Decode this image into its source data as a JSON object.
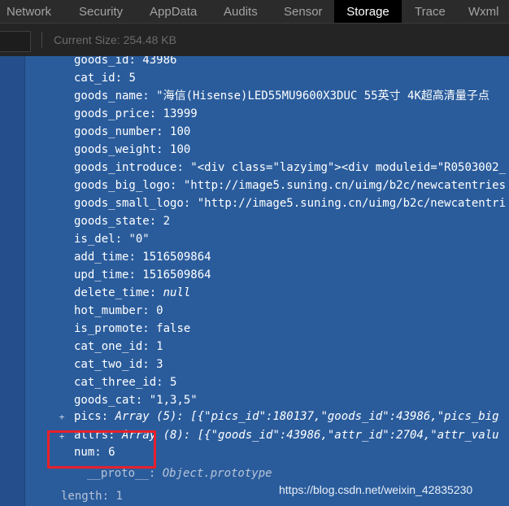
{
  "tabs": [
    "Network",
    "Security",
    "AppData",
    "Audits",
    "Sensor",
    "Storage",
    "Trace",
    "Wxml"
  ],
  "active_tab": "Storage",
  "toolbar": {
    "current_size": "Current Size:  254.48 KB"
  },
  "properties": [
    {
      "key": "goods_id",
      "value": "43986"
    },
    {
      "key": "cat_id",
      "value": "5"
    },
    {
      "key": "goods_name",
      "value": "\"海信(Hisense)LED55MU9600X3DUC 55英寸 4K超高清量子点"
    },
    {
      "key": "goods_price",
      "value": "13999"
    },
    {
      "key": "goods_number",
      "value": "100"
    },
    {
      "key": "goods_weight",
      "value": "100"
    },
    {
      "key": "goods_introduce",
      "value": "\"<div class=\"lazyimg\"><div moduleid=\"R0503002_"
    },
    {
      "key": "goods_big_logo",
      "value": "\"http://image5.suning.cn/uimg/b2c/newcatentries"
    },
    {
      "key": "goods_small_logo",
      "value": "\"http://image5.suning.cn/uimg/b2c/newcatentri"
    },
    {
      "key": "goods_state",
      "value": "2"
    },
    {
      "key": "is_del",
      "value": "\"0\""
    },
    {
      "key": "add_time",
      "value": "1516509864"
    },
    {
      "key": "upd_time",
      "value": "1516509864"
    },
    {
      "key": "delete_time",
      "value": "null"
    },
    {
      "key": "hot_mumber",
      "value": "0"
    },
    {
      "key": "is_promote",
      "value": "false"
    },
    {
      "key": "cat_one_id",
      "value": "1"
    },
    {
      "key": "cat_two_id",
      "value": "3"
    },
    {
      "key": "cat_three_id",
      "value": "5"
    },
    {
      "key": "goods_cat",
      "value": "\"1,3,5\""
    },
    {
      "key": "pics",
      "value": "Array (5): [{\"pics_id\":180137,\"goods_id\":43986,\"pics_big"
    },
    {
      "key": "attrs",
      "value": "Array (8): [{\"goods_id\":43986,\"attr_id\":2704,\"attr_valu"
    },
    {
      "key": "num",
      "value": "6"
    },
    {
      "key": "__proto__",
      "value": "Object.prototype"
    },
    {
      "key": "length",
      "value": "1"
    }
  ],
  "watermark": "https://blog.csdn.net/weixin_42835230",
  "colors": {
    "panel_bg": "#2a5c9c",
    "highlight_border": "#e8202a",
    "tab_active_bg": "#000000"
  }
}
